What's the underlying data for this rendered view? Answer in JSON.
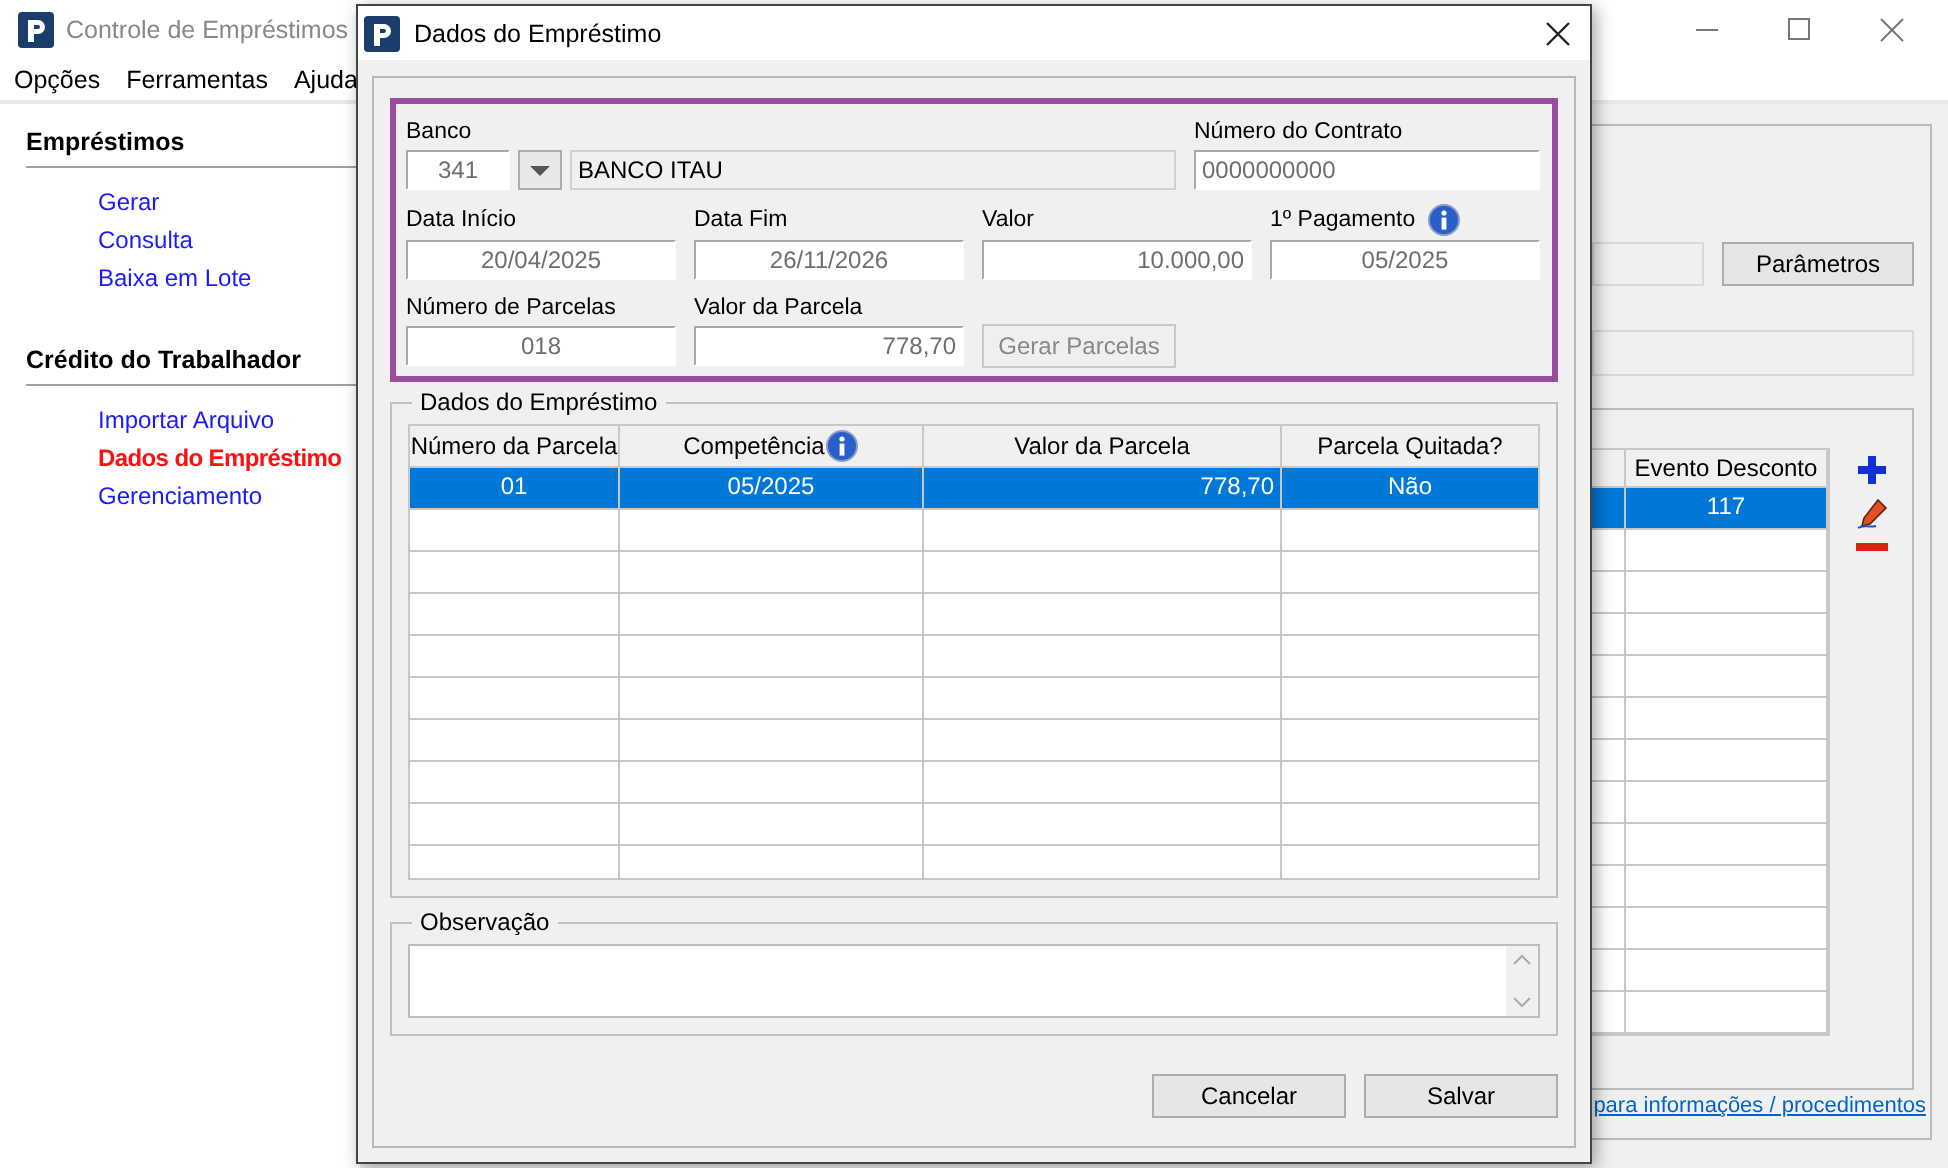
{
  "main_window": {
    "title": "Controle de Empréstimos",
    "menu": [
      "Opções",
      "Ferramentas",
      "Ajuda"
    ],
    "sidebar": [
      {
        "heading": "Empréstimos",
        "items": [
          {
            "label": "Gerar",
            "selected": false
          },
          {
            "label": "Consulta",
            "selected": false
          },
          {
            "label": "Baixa em Lote",
            "selected": false
          }
        ]
      },
      {
        "heading": "Crédito do Trabalhador",
        "items": [
          {
            "label": "Importar Arquivo",
            "selected": false
          },
          {
            "label": "Dados do Empréstimo",
            "selected": true
          },
          {
            "label": "Gerenciamento",
            "selected": false
          }
        ]
      }
    ],
    "parameters_button": "Parâmetros",
    "table": {
      "columns": [
        "",
        "Evento Desconto"
      ],
      "rows": [
        {
          "cells": [
            "",
            "117"
          ],
          "selected": true
        }
      ]
    },
    "link": "para informações / procedimentos"
  },
  "dialog": {
    "title": "Dados do Empréstimo",
    "banco": {
      "label": "Banco",
      "code": "341",
      "name": "BANCO ITAU"
    },
    "contrato": {
      "label": "Número do Contrato",
      "value": "0000000000"
    },
    "data_inicio": {
      "label": "Data Início",
      "value": "20/04/2025"
    },
    "data_fim": {
      "label": "Data Fim",
      "value": "26/11/2026"
    },
    "valor": {
      "label": "Valor",
      "value": "10.000,00"
    },
    "primeiro_pagamento": {
      "label": "1º Pagamento",
      "value": "05/2025",
      "info": true
    },
    "numero_parcelas": {
      "label": "Número de Parcelas",
      "value": "018"
    },
    "valor_parcela": {
      "label": "Valor da Parcela",
      "value": "778,70"
    },
    "gerar_button": {
      "label": "Gerar Parcelas",
      "disabled": true
    },
    "grid": {
      "title": "Dados do Empréstimo",
      "columns": [
        {
          "label": "Número da Parcela",
          "info": false
        },
        {
          "label": "Competência",
          "info": true
        },
        {
          "label": "Valor da Parcela",
          "info": false
        },
        {
          "label": "Parcela Quitada?",
          "info": false
        }
      ],
      "rows": [
        {
          "cells": [
            "01",
            "05/2025",
            "778,70",
            "Não"
          ],
          "selected": true
        }
      ]
    },
    "observacao": {
      "label": "Observação"
    },
    "buttons": [
      "Cancelar",
      "Salvar"
    ]
  }
}
